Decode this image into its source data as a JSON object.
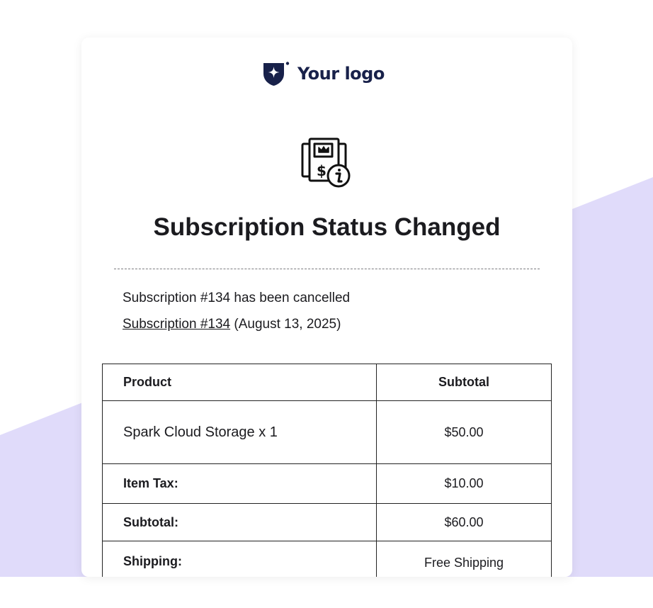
{
  "colors": {
    "page_background": "#ffffff",
    "accent_shape": "#e0dbfa",
    "logo_color": "#18214a",
    "text": "#1b1b1f"
  },
  "logo": {
    "icon": "shield-sparkle-icon",
    "text": "Your logo"
  },
  "hero": {
    "icon": "subscription-info-icon"
  },
  "email": {
    "title": "Subscription Status Changed",
    "message": "Subscription #134 has been cancelled",
    "subscription_link": "Subscription #134",
    "subscription_date": "(August 13, 2025)"
  },
  "table": {
    "headers": {
      "product": "Product",
      "subtotal": "Subtotal"
    },
    "items": [
      {
        "name": "Spark Cloud Storage x 1",
        "price": "$50.00"
      }
    ],
    "totals": [
      {
        "label": "Item Tax:",
        "value": "$10.00"
      },
      {
        "label": "Subtotal:",
        "value": "$60.00"
      },
      {
        "label": "Shipping:",
        "value": "Free Shipping"
      }
    ]
  }
}
